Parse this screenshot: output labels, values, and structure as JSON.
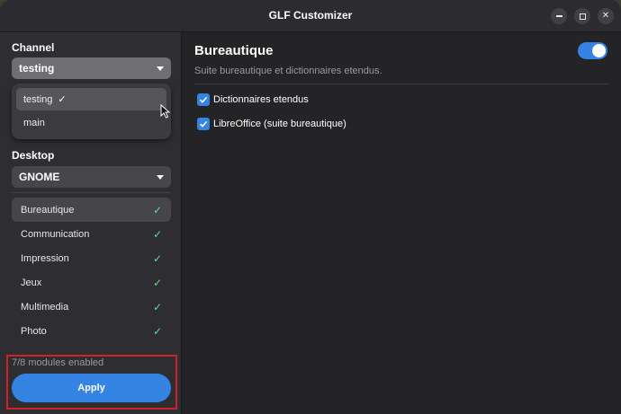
{
  "window": {
    "title": "GLF Customizer"
  },
  "sidebar": {
    "channel_label": "Channel",
    "channel_value": "testing",
    "channel_options": [
      {
        "label": "testing",
        "selected": true
      },
      {
        "label": "main",
        "selected": false
      }
    ],
    "desktop_label": "Desktop",
    "desktop_value": "GNOME",
    "modules": [
      {
        "label": "Bureautique",
        "enabled": true,
        "selected": true
      },
      {
        "label": "Communication",
        "enabled": true,
        "selected": false
      },
      {
        "label": "Impression",
        "enabled": true,
        "selected": false
      },
      {
        "label": "Jeux",
        "enabled": true,
        "selected": false
      },
      {
        "label": "Multimedia",
        "enabled": true,
        "selected": false
      },
      {
        "label": "Photo",
        "enabled": true,
        "selected": false
      }
    ],
    "status": "7/8 modules enabled",
    "apply_label": "Apply"
  },
  "content": {
    "title": "Bureautique",
    "subtitle": "Suite bureautique et dictionnaires etendus.",
    "module_enabled": true,
    "options": [
      {
        "label": "Dictionnaires etendus",
        "checked": true
      },
      {
        "label": "LibreOffice (suite bureautique)",
        "checked": true
      }
    ]
  },
  "colors": {
    "accent": "#3584e4",
    "check_green": "#57e389",
    "annotation_red": "#d0202a"
  },
  "icons": {
    "checkmark": "check-icon",
    "dropdown": "chevron-down-icon",
    "pointer": "mouse-pointer-icon"
  }
}
